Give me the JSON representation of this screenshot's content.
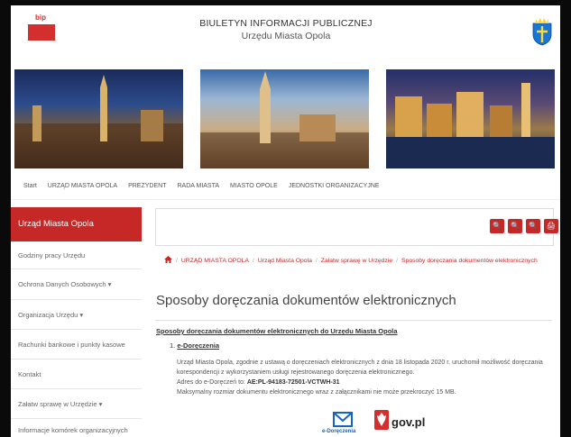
{
  "header": {
    "bip_label": "bip",
    "title_line1": "BIULETYN INFORMACJI PUBLICZNEJ",
    "title_line2": "Urzędu Miasta Opola"
  },
  "topnav": [
    "Start",
    "URZĄD MIASTA OPOLA",
    "PREZYDENT",
    "RADA MIASTA",
    "MIASTO OPOLE",
    "JEDNOSTKI ORGANIZACYJNE"
  ],
  "sidebar": {
    "heading": "Urząd Miasta Opola",
    "items": [
      "Godziny pracy Urzędu",
      "Ochrona Danych Osobowych ▾",
      "Organizacja Urzędu ▾",
      "Rachunki bankowe i punkty kasowe",
      "Kontakt",
      "Załatw sprawę w Urzędzie ▾",
      "Informacje komórek organizacyjnych"
    ]
  },
  "toolbar": {
    "buttons": [
      "🔍",
      "🔍",
      "🔍",
      "🖨"
    ]
  },
  "breadcrumb": [
    "URZĄD MIASTA OPOLA",
    "Urząd Miasta Opola",
    "Załatw sprawę w Urzędzie",
    "Sposoby doręczania dokumentów elektronicznych"
  ],
  "content": {
    "title": "Sposoby doręczania dokumentów elektronicznych",
    "subtitle": "Sposoby doręczania dokumentów elektronicznych do Urzędu Miasta Opola",
    "item_number": "1. ",
    "item_label": "e-Doręczenia",
    "para1": "Urząd Miasta Opola, zgodnie z ustawą o doręczeniach elektronicznych z dnia 18 listopada 2020 r. uruchomił możliwość doręczania korespondencji z wykorzystaniem usługi rejestrowanego doręczenia elektronicznego.",
    "address_label": "Adres do e-Doręczeń to: ",
    "address_value": "AE:PL-94183-72501-VCTWH-31",
    "para2": "Maksymalny rozmiar dokumentu elektronicznego wraz z załącznikami nie może przekroczyć 15 MB."
  },
  "logos": {
    "edoreczenia_label": "e-Doręczenia",
    "gov_label": "gov.pl"
  },
  "colors": {
    "accent": "#c62828",
    "text": "#333333",
    "link": "#c62828"
  }
}
